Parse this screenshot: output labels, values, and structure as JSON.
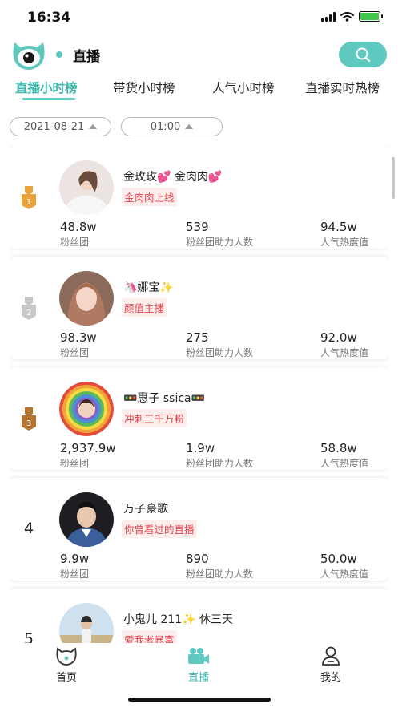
{
  "status_bar": {
    "time": "16:34"
  },
  "header": {
    "title": "直播"
  },
  "tabs": [
    {
      "label": "直播小时榜",
      "active": true
    },
    {
      "label": "带货小时榜",
      "active": false
    },
    {
      "label": "人气小时榜",
      "active": false
    },
    {
      "label": "直播实时热榜",
      "active": false
    }
  ],
  "filters": {
    "date": "2021-08-21",
    "time": "01:00"
  },
  "rankings": [
    {
      "rank": "1",
      "name": "金玫玫💕 金肉肉💕",
      "tag": "金肉肉上线",
      "stats": [
        {
          "value": "48.8w",
          "label": "粉丝团"
        },
        {
          "value": "539",
          "label": "粉丝团助力人数"
        },
        {
          "value": "94.5w",
          "label": "人气热度值"
        }
      ]
    },
    {
      "rank": "2",
      "name": "🦄娜宝✨",
      "tag": "颜值主播",
      "stats": [
        {
          "value": "98.3w",
          "label": "粉丝团"
        },
        {
          "value": "275",
          "label": "粉丝团助力人数"
        },
        {
          "value": "92.0w",
          "label": "人气热度值"
        }
      ]
    },
    {
      "rank": "3",
      "name": "🚥惠子 ssica🚥",
      "tag": "冲刺三千万粉",
      "stats": [
        {
          "value": "2,937.9w",
          "label": "粉丝团"
        },
        {
          "value": "1.9w",
          "label": "粉丝团助力人数"
        },
        {
          "value": "58.8w",
          "label": "人气热度值"
        }
      ]
    },
    {
      "rank": "4",
      "name": "万子豪歌",
      "tag": "你曾看过的直播",
      "stats": [
        {
          "value": "9.9w",
          "label": "粉丝团"
        },
        {
          "value": "890",
          "label": "粉丝团助力人数"
        },
        {
          "value": "50.0w",
          "label": "人气热度值"
        }
      ]
    },
    {
      "rank": "5",
      "name": "小鬼儿 211✨ 休三天",
      "tag": "爱我者暴富"
    }
  ],
  "bottom_nav": [
    {
      "label": "首页",
      "icon": "home-icon",
      "active": false
    },
    {
      "label": "直播",
      "icon": "camera-icon",
      "active": true
    },
    {
      "label": "我的",
      "icon": "profile-icon",
      "active": false
    }
  ],
  "colors": {
    "accent": "#5fc9bf",
    "tag_text": "#e3424a",
    "gold": "#e8a43a",
    "silver": "#c8c8c8",
    "bronze": "#b7742f"
  }
}
